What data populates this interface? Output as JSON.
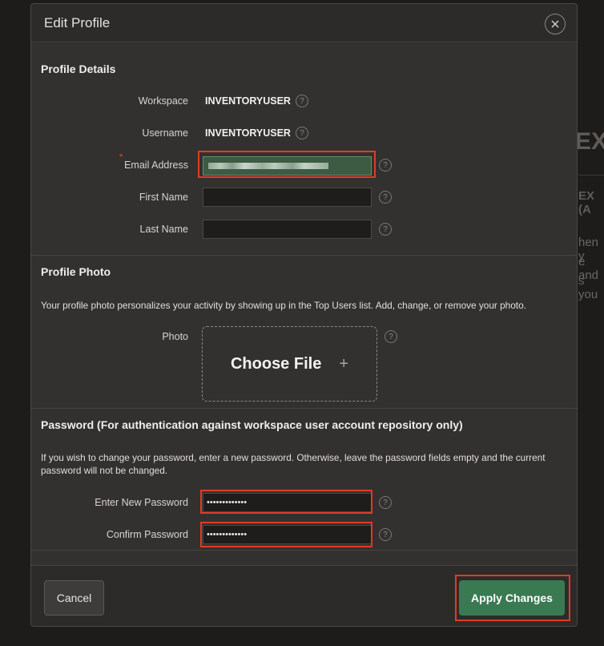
{
  "background": {
    "title_fragment": "EX",
    "subtitle_fragment": "EX (A",
    "para_lines": [
      "hen y",
      "e and",
      "s you"
    ]
  },
  "dialog": {
    "title": "Edit Profile",
    "close_icon": "close-icon"
  },
  "profile_details": {
    "title": "Profile Details",
    "workspace_label": "Workspace",
    "workspace_value": "INVENTORYUSER",
    "username_label": "Username",
    "username_value": "INVENTORYUSER",
    "email_label": "Email Address",
    "email_required_marker": "*",
    "first_name_label": "First Name",
    "first_name_value": "",
    "last_name_label": "Last Name",
    "last_name_value": ""
  },
  "profile_photo": {
    "title": "Profile Photo",
    "description": "Your profile photo personalizes your activity by showing up in the Top Users list. Add, change, or remove your photo.",
    "photo_label": "Photo",
    "choose_file_label": "Choose File",
    "plus_glyph": "+"
  },
  "password": {
    "title": "Password (For authentication against workspace user account repository only)",
    "description": "If you wish to change your password, enter a new password. Otherwise, leave the password fields empty and the current password will not be changed.",
    "new_password_label": "Enter New Password",
    "new_password_value": "•••••••••••••",
    "confirm_password_label": "Confirm Password",
    "confirm_password_value": "•••••••••••••"
  },
  "help_glyph": "?",
  "footer": {
    "cancel_label": "Cancel",
    "apply_label": "Apply Changes"
  },
  "colors": {
    "highlight": "#e03b24",
    "apply_button": "#3a7a52",
    "email_field": "#3d5a43"
  }
}
